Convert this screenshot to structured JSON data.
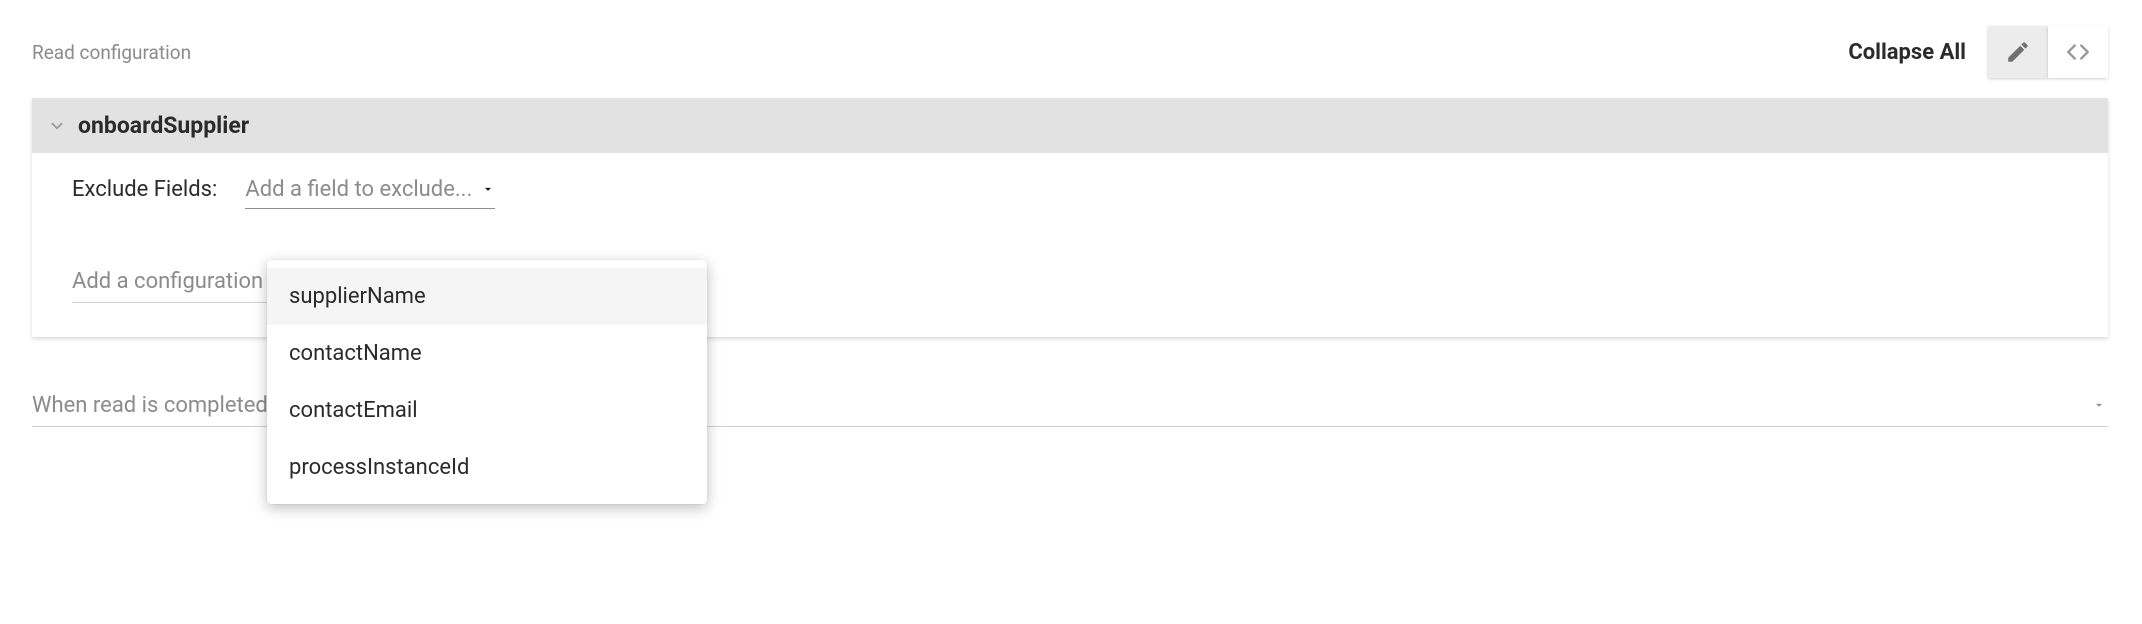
{
  "header": {
    "title": "Read configuration",
    "collapse_label": "Collapse All"
  },
  "icons": {
    "edit": "pencil-icon",
    "code": "code-icon"
  },
  "accordion": {
    "name": "onboardSupplier",
    "expanded": true
  },
  "body": {
    "exclude_label": "Exclude Fields:",
    "exclude_placeholder": "Add a field to exclude...",
    "add_config_placeholder": "Add a configuration"
  },
  "dropdown": {
    "open": true,
    "highlighted_index": 0,
    "items": [
      "supplierName",
      "contactName",
      "contactEmail",
      "processInstanceId"
    ]
  },
  "bottom_select": {
    "placeholder": "When read is completed"
  },
  "colors": {
    "header_bg": "#e2e2e2",
    "muted": "#8b8b8b",
    "icon_gray": "#707070"
  }
}
